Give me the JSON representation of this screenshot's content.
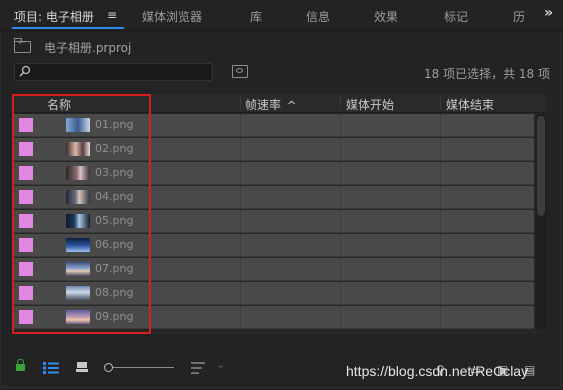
{
  "tabs": [
    {
      "label": "项目: 电子相册",
      "active": true
    },
    {
      "label": "媒体浏览器",
      "active": false
    },
    {
      "label": "库",
      "active": false
    },
    {
      "label": "信息",
      "active": false
    },
    {
      "label": "效果",
      "active": false
    },
    {
      "label": "标记",
      "active": false
    },
    {
      "label": "历",
      "active": false
    }
  ],
  "menu_icon": "≡",
  "overflow_icon": "»",
  "project": {
    "name": "电子相册.prproj"
  },
  "search": {
    "placeholder": "",
    "value": ""
  },
  "selection_status": "18 项已选择，共 18 项",
  "columns": {
    "name": "名称",
    "frame_rate": "帧速率",
    "media_start": "媒体开始",
    "media_end": "媒体结束"
  },
  "sort_indicator": "^",
  "rows": [
    {
      "name": "01.png"
    },
    {
      "name": "02.png"
    },
    {
      "name": "03.png"
    },
    {
      "name": "04.png"
    },
    {
      "name": "05.png"
    },
    {
      "name": "06.png"
    },
    {
      "name": "07.png"
    },
    {
      "name": "08.png"
    },
    {
      "name": "09.png"
    }
  ],
  "label_color": "#e187e0",
  "accent_color": "#2d8ceb",
  "annotation_color": "#d61e1e",
  "footer": {
    "icons": [
      "lock-icon",
      "list-view-icon",
      "icon-view-icon",
      "zoom-slider",
      "sort-menu-icon",
      "search-icon",
      "new-bin-icon",
      "new-item-icon",
      "clear-icon"
    ]
  },
  "watermark": "https://blog.csdn.net/ReCclay"
}
